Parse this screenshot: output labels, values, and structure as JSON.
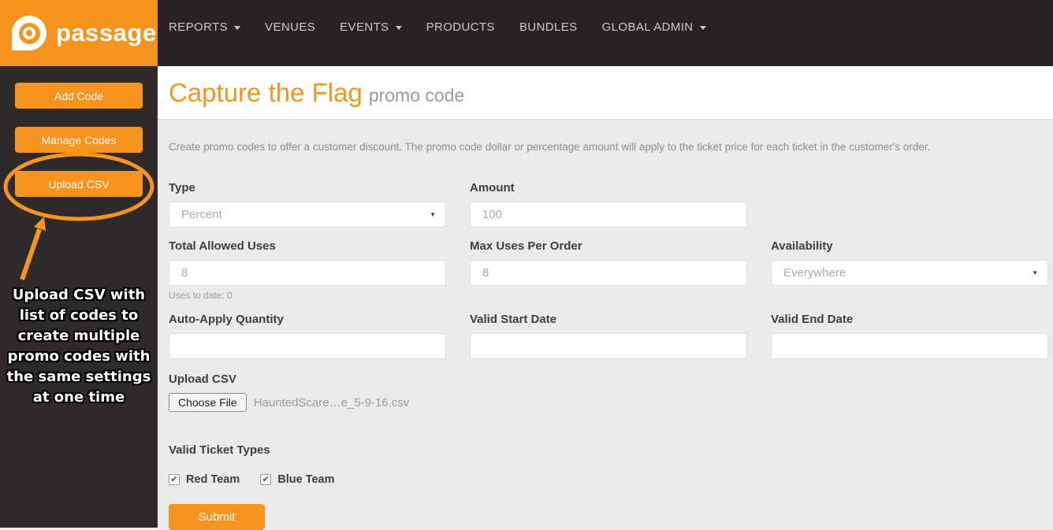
{
  "brand": {
    "name": "passage"
  },
  "nav": {
    "items": [
      {
        "label": "REPORTS",
        "caret": true
      },
      {
        "label": "VENUES",
        "caret": false
      },
      {
        "label": "EVENTS",
        "caret": true
      },
      {
        "label": "PRODUCTS",
        "caret": false
      },
      {
        "label": "BUNDLES",
        "caret": false
      },
      {
        "label": "GLOBAL ADMIN",
        "caret": true
      }
    ]
  },
  "sidebar": {
    "buttons": [
      "Add Code",
      "Manage Codes",
      "Upload CSV"
    ],
    "annotation": "Upload CSV with list of codes to create multiple promo codes with the same settings at one time"
  },
  "header": {
    "title": "Capture the Flag",
    "subtitle": "promo code"
  },
  "intro": "Create promo codes to offer a customer discount. The promo code dollar or percentage amount will apply to the ticket price for each ticket in the customer's order.",
  "form": {
    "type": {
      "label": "Type",
      "value": "Percent"
    },
    "amount": {
      "label": "Amount",
      "value": "100"
    },
    "total_allowed_uses": {
      "label": "Total Allowed Uses",
      "value": "8",
      "helper": "Uses to date: 0"
    },
    "max_uses_per_order": {
      "label": "Max Uses Per Order",
      "value": "8"
    },
    "availability": {
      "label": "Availability",
      "value": "Everywhere"
    },
    "auto_apply_quantity": {
      "label": "Auto-Apply Quantity",
      "value": ""
    },
    "valid_start_date": {
      "label": "Valid Start Date",
      "value": ""
    },
    "valid_end_date": {
      "label": "Valid End Date",
      "value": ""
    },
    "upload_csv": {
      "label": "Upload CSV",
      "button": "Choose File",
      "filename": "HauntedScare…e_5-9-16.csv"
    },
    "valid_ticket_types": {
      "label": "Valid Ticket Types",
      "options": [
        {
          "label": "Red Team",
          "checked": true
        },
        {
          "label": "Blue Team",
          "checked": true
        }
      ]
    },
    "submit_label": "Submit"
  },
  "colors": {
    "accent": "#F7941E",
    "topbar": "#272324",
    "sidebar": "#2E2A2B",
    "content_bg": "#EBEBEB"
  }
}
